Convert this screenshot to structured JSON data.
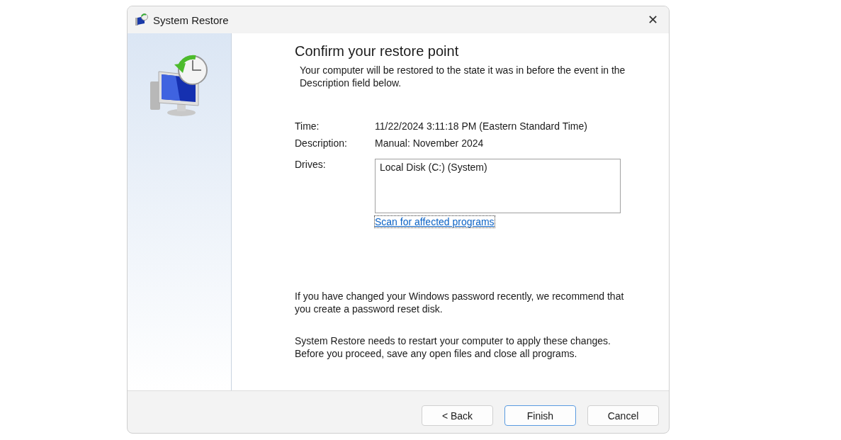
{
  "window": {
    "title": "System Restore",
    "close": "✕"
  },
  "heading": "Confirm your restore point",
  "intro": "Your computer will be restored to the state it was in before the event in the Description field below.",
  "details": [
    {
      "label": "Time:",
      "value": "11/22/2024 3:11:18 PM (Eastern Standard Time)"
    },
    {
      "label": "Description:",
      "value": "Manual: November 2024"
    }
  ],
  "drives": {
    "label": "Drives:",
    "items": [
      "Local Disk (C:) (System)"
    ]
  },
  "scan_link": {
    "text": "Scan for affected programs",
    "focused": true
  },
  "notes": [
    "If you have changed your Windows password recently, we recommend that you create a password reset disk.",
    "System Restore needs to restart your computer to apply these changes. Before you proceed, save any open files and close all programs."
  ],
  "buttons": [
    {
      "label": "< Back",
      "default": false
    },
    {
      "label": "Finish",
      "default": true
    },
    {
      "label": "Cancel",
      "default": false
    }
  ]
}
